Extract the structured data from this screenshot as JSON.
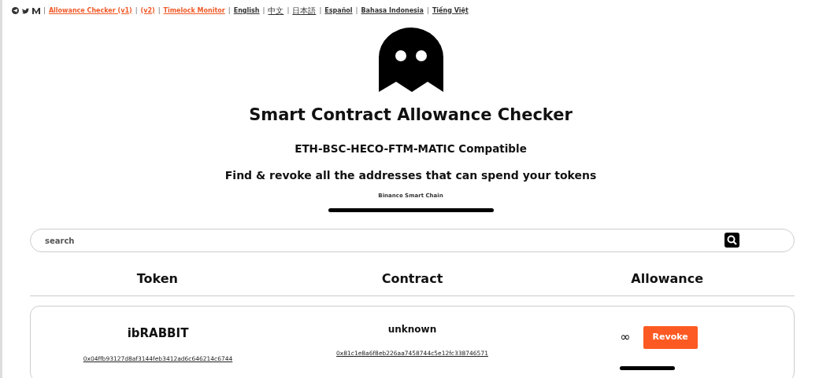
{
  "top_bar": [
    {
      "kind": "separator",
      "label": "|"
    },
    {
      "kind": "app",
      "label": "Allowance Checker (v1)"
    },
    {
      "kind": "separator",
      "label": "|"
    },
    {
      "kind": "app",
      "label": "(v2)"
    },
    {
      "kind": "separator",
      "label": "|"
    },
    {
      "kind": "app",
      "label": "Timelock Monitor"
    },
    {
      "kind": "separator",
      "label": "|"
    },
    {
      "kind": "language",
      "label": "English"
    },
    {
      "kind": "separator",
      "label": "|"
    },
    {
      "kind": "language",
      "label": "中文"
    },
    {
      "kind": "separator",
      "label": "|"
    },
    {
      "kind": "language",
      "label": "日本語"
    },
    {
      "kind": "separator",
      "label": "|"
    },
    {
      "kind": "language",
      "label": "Español"
    },
    {
      "kind": "separator",
      "label": "|"
    },
    {
      "kind": "language",
      "label": "Bahasa Indonesia"
    },
    {
      "kind": "separator",
      "label": "|"
    },
    {
      "kind": "language",
      "label": "Tiếng Việt"
    }
  ],
  "title": "Smart Contract Allowance Checker",
  "subtitle": "ETH-BSC-HECO-FTM-MATIC Compatible",
  "tagline": "Find & revoke all the addresses that can spend your tokens",
  "network": "Binance Smart Chain",
  "search": {
    "placeholder": "search"
  },
  "table": {
    "columns": [
      "Token",
      "Contract",
      "Allowance"
    ],
    "rows": [
      {
        "token": "ibRABBIT",
        "token_address": "0x04ffb93127d8af3144feb3412ad6c646214c6744",
        "contract": "unknown",
        "contract_address": "0x81c1e8a6f8eb226aa7458744c5e12fc338746571",
        "allowance": "∞",
        "action": "Revoke"
      }
    ]
  }
}
